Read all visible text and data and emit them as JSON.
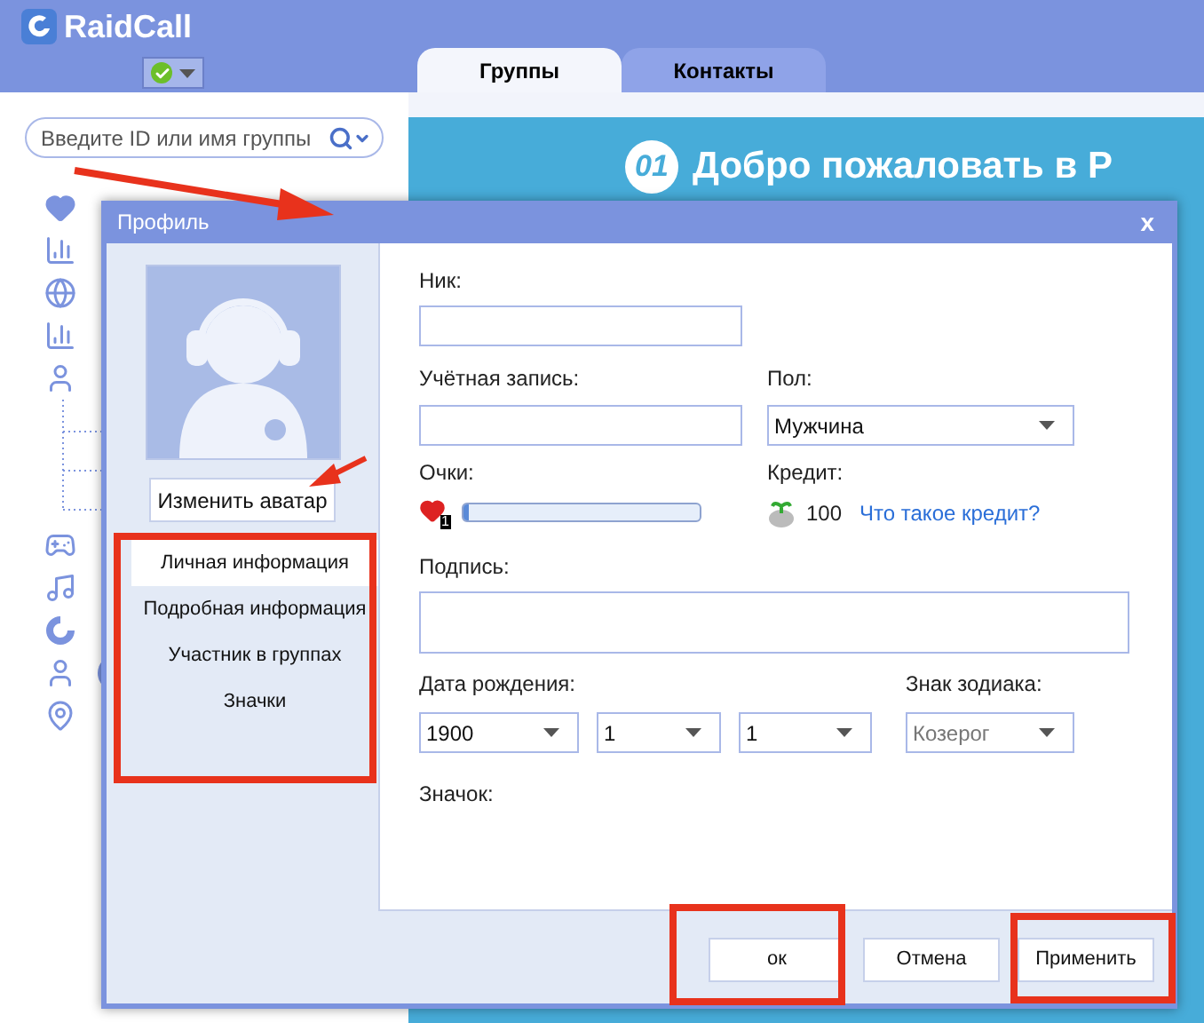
{
  "app": {
    "logo": "RaidCall"
  },
  "tabs": [
    {
      "label": "Группы",
      "selected": true
    },
    {
      "label": "Контакты",
      "selected": false
    }
  ],
  "search": {
    "placeholder": "Введите ID или имя группы"
  },
  "sidebar": {
    "items": [
      {
        "kind": "heart"
      },
      {
        "kind": "bars"
      },
      {
        "kind": "globe"
      },
      {
        "kind": "bars"
      },
      {
        "kind": "user"
      },
      {
        "kind": "tree"
      },
      {
        "kind": "gamepad"
      },
      {
        "kind": "music"
      },
      {
        "kind": "logo"
      },
      {
        "kind": "badge"
      },
      {
        "kind": "pin"
      }
    ]
  },
  "welcome": {
    "number": "01",
    "title": "Добро пожаловать в Р"
  },
  "dialog": {
    "title": "Профиль",
    "close": "x",
    "change_avatar": "Изменить аватар",
    "nav": [
      {
        "label": "Личная информация",
        "selected": true
      },
      {
        "label": "Подробная информация",
        "selected": false
      },
      {
        "label": "Участник в группах",
        "selected": false
      },
      {
        "label": "Значки",
        "selected": false
      }
    ],
    "nick_label": "Ник:",
    "account_label": "Учётная запись:",
    "gender_label": "Пол:",
    "gender": "Мужчина",
    "points_label": "Очки:",
    "points": {
      "badge": "1",
      "level": 0.02
    },
    "credit_label": "Кредит:",
    "credit": "100",
    "credit_link": "Что такое кредит?",
    "signature_label": "Подпись:",
    "birth_label": "Дата рождения:",
    "birth": [
      "1900",
      "1",
      "1"
    ],
    "zodiac_label": "Знак зодиака:",
    "zodiac": {
      "value": "Козерог",
      "disabled": true
    },
    "badge_label": "Значок:",
    "buttons": [
      {
        "label": "ок"
      },
      {
        "label": "Отмена"
      },
      {
        "label": "Применить"
      }
    ]
  }
}
